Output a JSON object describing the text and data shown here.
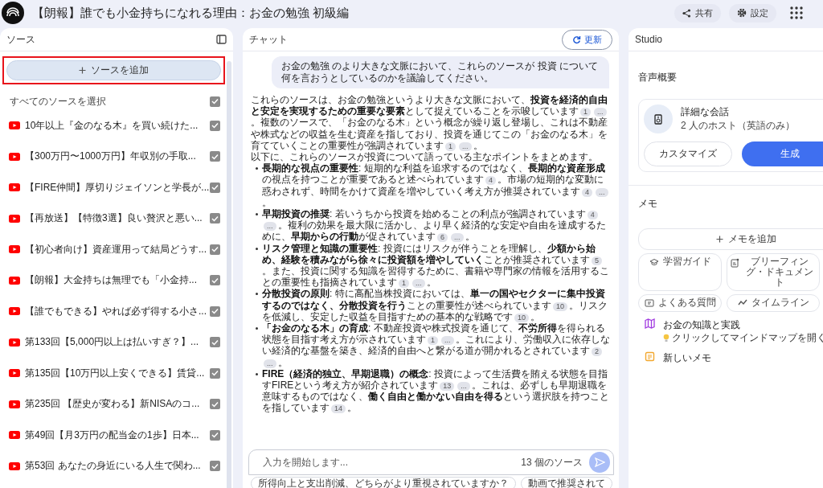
{
  "window": {
    "title": "【朗報】誰でも小金持ちになれる理由：お金の勉強 初級編"
  },
  "toolbar": {
    "share": "共有",
    "settings": "設定"
  },
  "sources": {
    "title": "ソース",
    "add_button": "ソースを追加",
    "highlighted": true,
    "select_all": {
      "label": "すべてのソースを選択",
      "checked": true
    },
    "items": [
      {
        "title": "10年以上『金のなる木』を買い続けた...",
        "checked": true
      },
      {
        "title": "【300万円〜1000万円】年収別の手取...",
        "checked": true
      },
      {
        "title": "【FIRE仲間】厚切りジェイソンと学長が...",
        "checked": true
      },
      {
        "title": "【再放送】【特徴3選】良い贅沢と悪い...",
        "checked": true
      },
      {
        "title": "【初心者向け】資産運用って結局どうす...",
        "checked": true
      },
      {
        "title": "【朗報】大金持ちは無理でも「小金持...",
        "checked": true
      },
      {
        "title": "【誰でもできる】やれば必ず得する小さ...",
        "checked": true
      },
      {
        "title": "第133回【5,000円以上は払いすぎ？】...",
        "checked": true
      },
      {
        "title": "第135回【10万円以上安くできる】賃貸...",
        "checked": true
      },
      {
        "title": "第235回 【歴史が変わる】新NISAのコ...",
        "checked": true
      },
      {
        "title": "第49回【月3万円の配当金の1歩】日本...",
        "checked": true
      },
      {
        "title": "第53回 あなたの身近にいる人生で関わ...",
        "checked": true
      }
    ]
  },
  "chat": {
    "title": "チャット",
    "refresh_button": "更新",
    "user_message": "お金の勉強 のより大きな文脈において、これらのソースが 投資 について何を言おうとしているのかを議論してください。",
    "answer": [
      {
        "kind": "paragraph",
        "segments": [
          {
            "text": "これらのソースは、お金の勉強というより大きな文脈において、**投資を経済的自由と安定を実現するための重要な要素**として捉えていることを示唆しています"
          },
          {
            "cite": "1"
          },
          {
            "cite": "..."
          },
          {
            "text": "。複数のソースで、「お金のなる木」という概念が繰り返し登場し、これは不動産や株式などの収益を生む資産を指しており、投資を通じてこの「お金のなる木」を育てていくことの重要性が強調されています"
          },
          {
            "cite": "1"
          },
          {
            "cite": "..."
          },
          {
            "text": "。"
          }
        ]
      },
      {
        "kind": "paragraph",
        "segments": [
          {
            "text": "以下に、これらのソースが投資について語っている主なポイントをまとめます。"
          }
        ]
      },
      {
        "kind": "bullet",
        "segments": [
          {
            "text": "**長期的な視点の重要性**: 短期的な利益を追求するのではなく、**長期的な資産形成**の視点を持つことが重要であると述べられています"
          },
          {
            "cite": "4"
          },
          {
            "text": "。市場の短期的な変動に惑わされず、時間をかけて資産を増やしていく考え方が推奨されています"
          },
          {
            "cite": "4"
          },
          {
            "cite": "..."
          },
          {
            "text": "。"
          }
        ]
      },
      {
        "kind": "bullet",
        "segments": [
          {
            "text": "**早期投資の推奨**: 若いうちから投資を始めることの利点が強調されています"
          },
          {
            "cite": "4"
          },
          {
            "cite": "..."
          },
          {
            "text": "。複利の効果を最大限に活かし、より早く経済的な安定や自由を達成するために、**早期からの行動**が促されています"
          },
          {
            "cite": "6"
          },
          {
            "cite": "..."
          },
          {
            "text": "。"
          }
        ]
      },
      {
        "kind": "bullet",
        "segments": [
          {
            "text": "**リスク管理と知識の重要性**: 投資にはリスクが伴うことを理解し、**少額から始め、経験を積みながら徐々に投資額を増やしていく**ことが推奨されています"
          },
          {
            "cite": "5"
          },
          {
            "text": "。また、投資に関する知識を習得するために、書籍や専門家の情報を活用することの重要性も指摘されています"
          },
          {
            "cite": "1"
          },
          {
            "cite": "..."
          },
          {
            "text": "。"
          }
        ]
      },
      {
        "kind": "bullet",
        "segments": [
          {
            "text": "**分散投資の原則**: 特に高配当株投資においては、**単一の国やセクターに集中投資するのではなく、分散投資を行う**ことの重要性が述べられています"
          },
          {
            "cite": "10"
          },
          {
            "text": "。リスクを低減し、安定した収益を目指すための基本的な戦略です"
          },
          {
            "cite": "10"
          },
          {
            "text": "。"
          }
        ]
      },
      {
        "kind": "bullet",
        "segments": [
          {
            "text": "**「お金のなる木」の育成**: 不動産投資や株式投資を通じて、**不労所得**を得られる状態を目指す考え方が示されています"
          },
          {
            "cite": "1"
          },
          {
            "cite": "..."
          },
          {
            "text": "。これにより、労働収入に依存しない経済的な基盤を築き、経済的自由へと繋がる道が開かれるとされています"
          },
          {
            "cite": "2"
          },
          {
            "cite": "..."
          },
          {
            "text": "。"
          }
        ]
      },
      {
        "kind": "bullet",
        "segments": [
          {
            "text": "**FIRE（経済的独立、早期退職）の概念**: 投資によって生活費を賄える状態を目指すFIREという考え方が紹介されています"
          },
          {
            "cite": "13"
          },
          {
            "cite": "..."
          },
          {
            "text": "。これは、必ずしも早期退職を意味するものではなく、**働く自由と働かない自由を得る**という選択肢を持つことを指しています"
          },
          {
            "cite": "14"
          },
          {
            "text": "。"
          }
        ]
      }
    ],
    "input": {
      "placeholder": "入力を開始します...",
      "source_count": "13 個のソース"
    },
    "suggestions": [
      "所得向上と支出削減、どちらがより重視されていますか？",
      "動画で推奨されて"
    ]
  },
  "studio": {
    "title": "Studio",
    "audio": {
      "title": "音声概要",
      "name": "詳細な会話",
      "subtitle": "2 人のホスト（英語のみ）",
      "customize": "カスタマイズ",
      "generate": "生成"
    },
    "memo": {
      "title": "メモ",
      "add_button": "メモを追加",
      "tools": [
        {
          "kind": "guide",
          "label": "学習ガイド"
        },
        {
          "kind": "briefing",
          "label": "ブリーフィング・ドキュメント"
        },
        {
          "kind": "faq",
          "label": "よくある質問"
        },
        {
          "kind": "timeline",
          "label": "タイムライン"
        }
      ],
      "notes": [
        {
          "kind": "mindmap",
          "title": "お金の知識と実践",
          "hint": "クリックしてマインドマップを開く"
        },
        {
          "kind": "note",
          "title": "新しいメモ"
        }
      ]
    }
  }
}
